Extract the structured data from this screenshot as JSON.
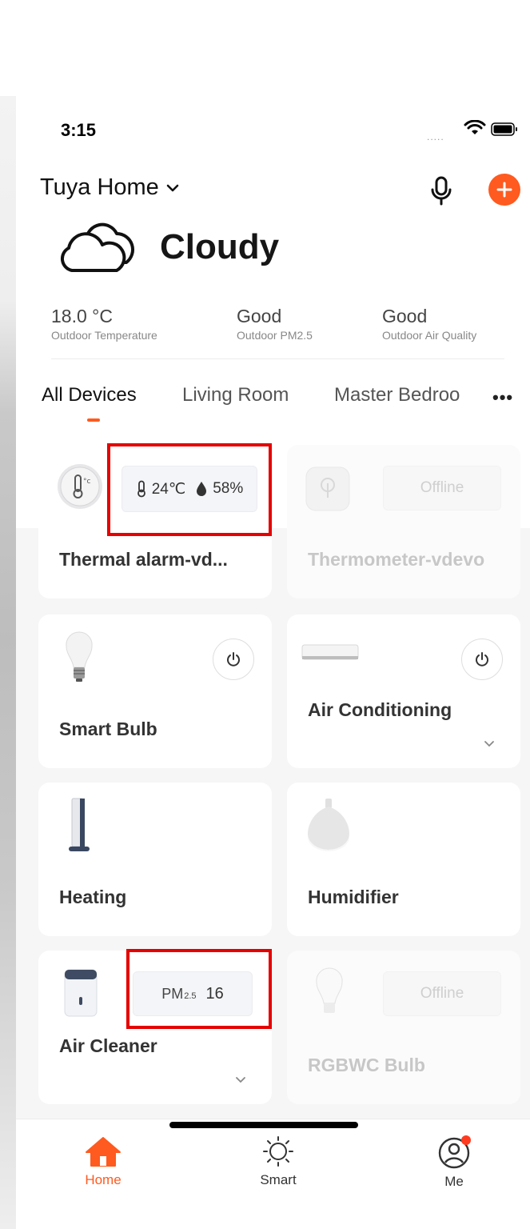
{
  "status_bar": {
    "time": "3:15",
    "signal": "....."
  },
  "header": {
    "home_name": "Tuya Home"
  },
  "weather": {
    "condition": "Cloudy",
    "stats": [
      {
        "value": "18.0 °C",
        "label": "Outdoor Temperature"
      },
      {
        "value": "Good",
        "label": "Outdoor PM2.5"
      },
      {
        "value": "Good",
        "label": "Outdoor Air Quality"
      }
    ]
  },
  "tabs": [
    {
      "label": "All Devices",
      "active": true
    },
    {
      "label": "Living Room",
      "active": false
    },
    {
      "label": "Master Bedroo",
      "active": false
    }
  ],
  "more_label": "•••",
  "devices": {
    "thermal": {
      "name": "Thermal alarm-vd...",
      "temp": "24℃",
      "humidity": "58%"
    },
    "thermometer": {
      "name": "Thermometer-vdevo",
      "status": "Offline"
    },
    "bulb": {
      "name": "Smart Bulb"
    },
    "ac": {
      "name": "Air Conditioning"
    },
    "heating": {
      "name": "Heating"
    },
    "humidifier": {
      "name": "Humidifier"
    },
    "cleaner": {
      "name": "Air Cleaner",
      "pm_label": "PM",
      "pm_sub": "2.5",
      "pm_value": "16"
    },
    "rgbwc": {
      "name": "RGBWC Bulb",
      "status": "Offline"
    }
  },
  "nav": [
    {
      "label": "Home",
      "active": true
    },
    {
      "label": "Smart",
      "active": false
    },
    {
      "label": "Me",
      "active": false
    }
  ],
  "colors": {
    "accent": "#ff5a1f",
    "highlight": "#e60000"
  }
}
